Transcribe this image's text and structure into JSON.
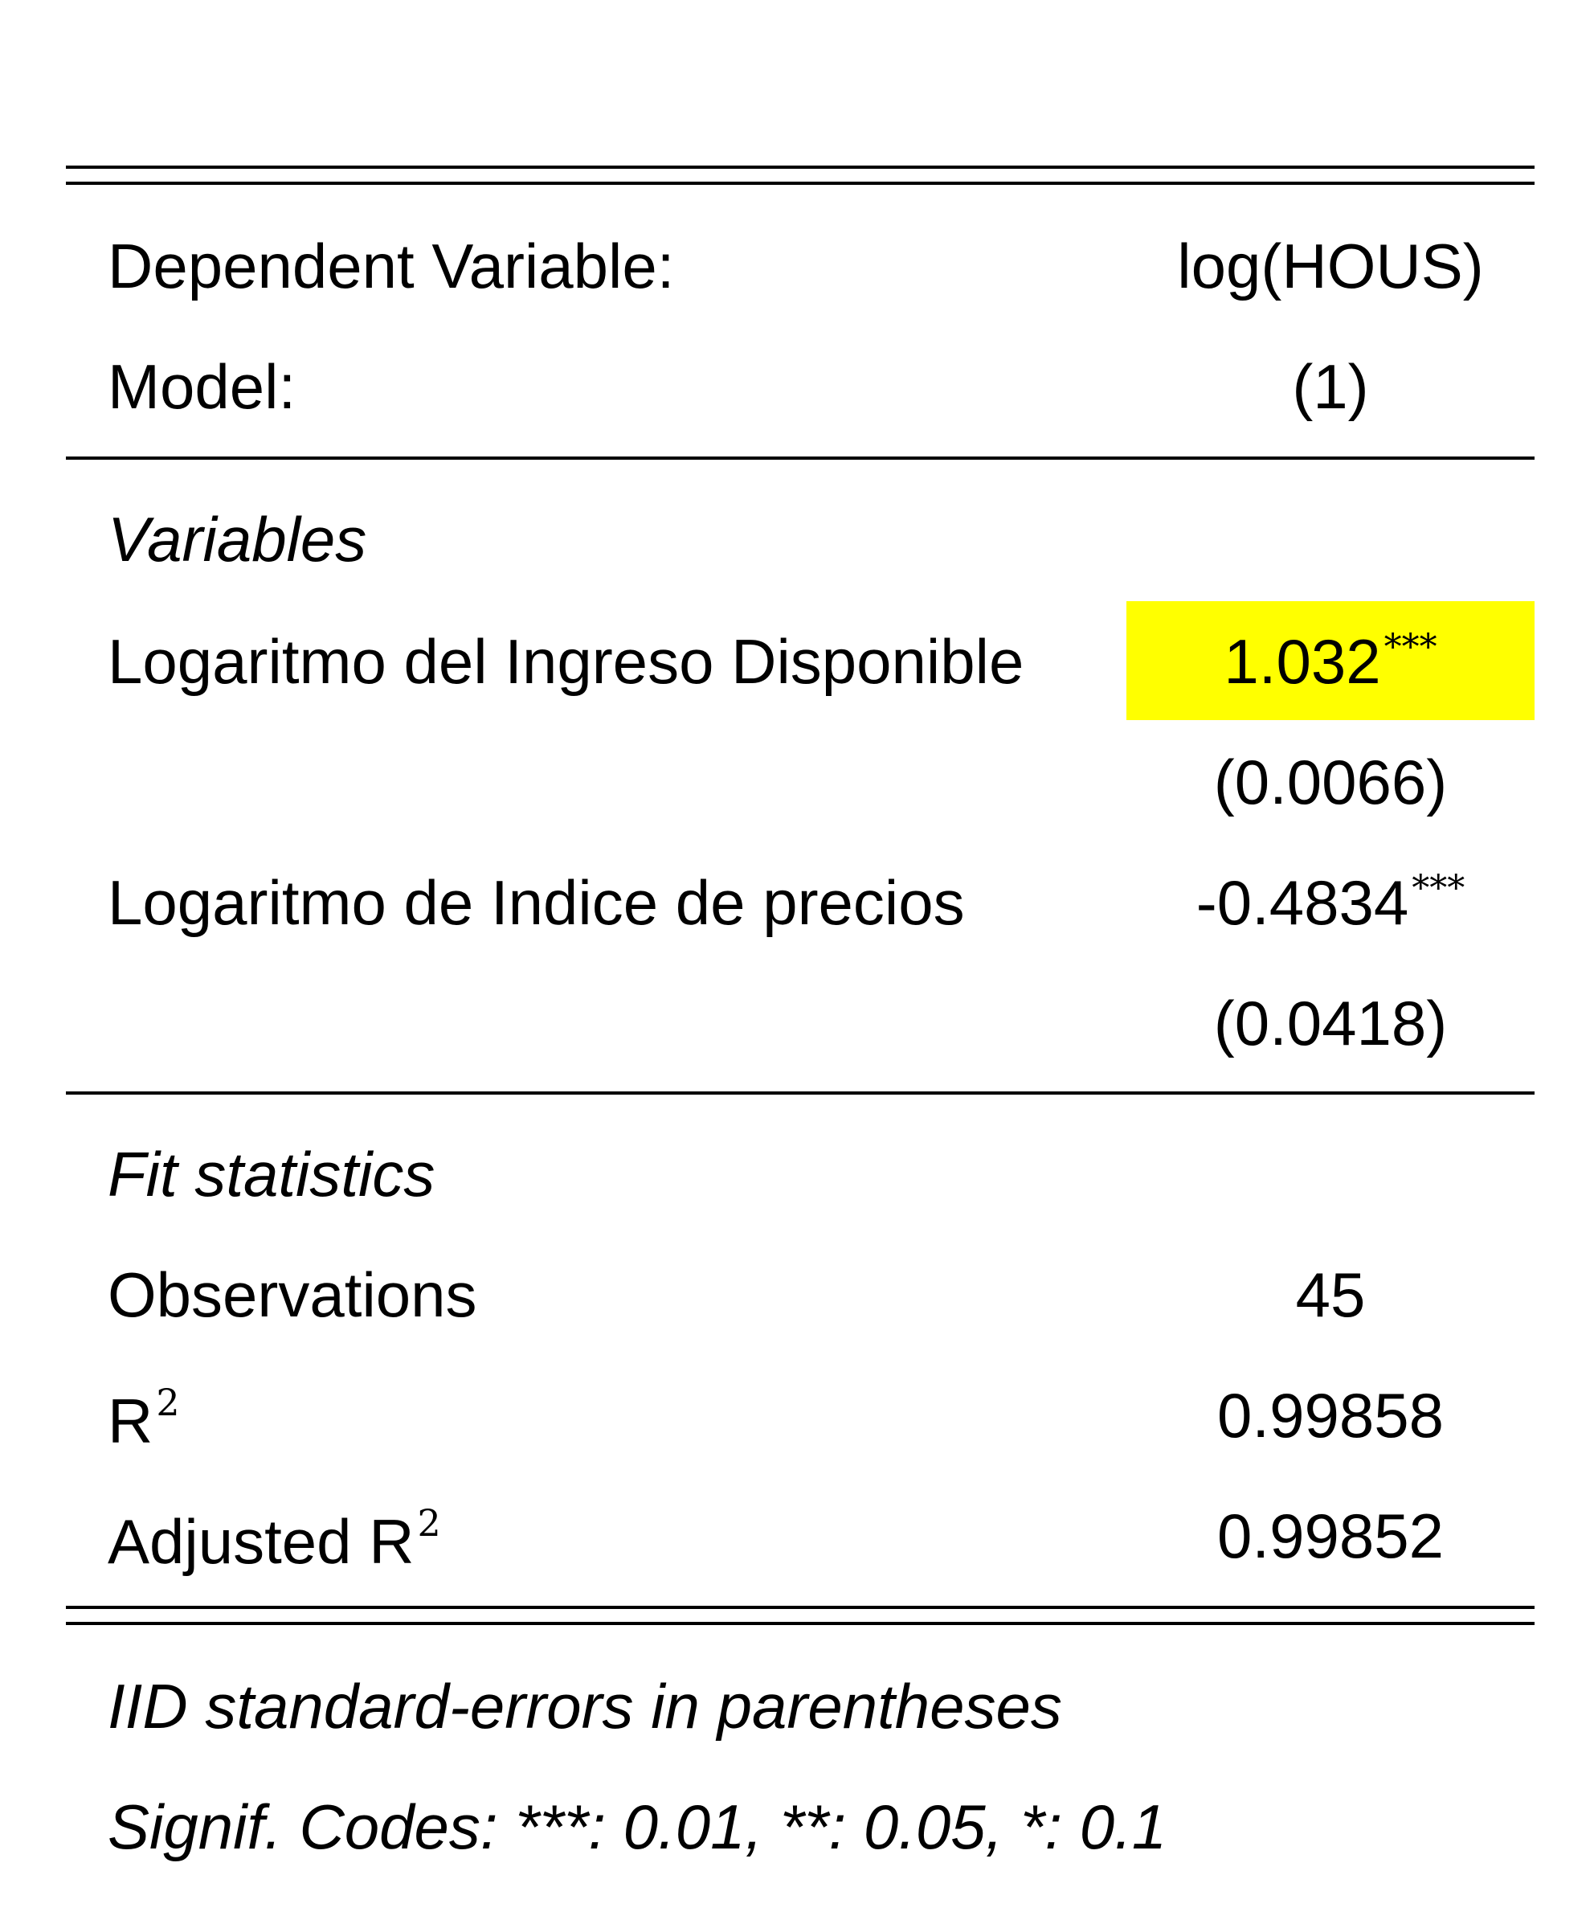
{
  "table": {
    "header": {
      "dependent_label": "Dependent Variable:",
      "dependent_value": "log(HOUS)",
      "model_label": "Model:",
      "model_value": "(1)"
    },
    "variables_section": "Variables",
    "variables": [
      {
        "label": "Logaritmo del Ingreso Disponible",
        "coef": "1.032",
        "stars": "***",
        "se": "(0.0066)",
        "highlighted": true
      },
      {
        "label": "Logaritmo de Indice de precios",
        "coef": "-0.4834",
        "stars": "***",
        "se": "(0.0418)",
        "highlighted": false
      }
    ],
    "fit_section": "Fit statistics",
    "fit": {
      "obs_label": "Observations",
      "obs_value": "45",
      "r2_label": "R",
      "r2_sup": "2",
      "r2_value": "0.99858",
      "adj_r2_label": "Adjusted R",
      "adj_r2_sup": "2",
      "adj_r2_value": "0.99852"
    },
    "notes": [
      "IID standard-errors in parentheses",
      "Signif. Codes: ***: 0.01, **: 0.05, *: 0.1"
    ]
  },
  "colors": {
    "highlight": "#ffff00",
    "text": "#000000",
    "rule": "#000000"
  }
}
